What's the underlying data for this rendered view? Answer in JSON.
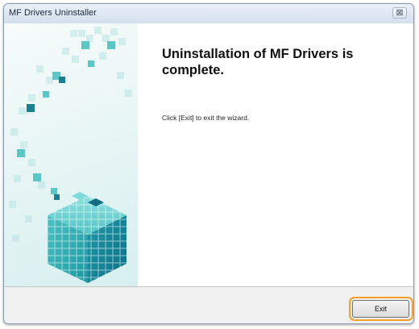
{
  "window": {
    "title": "MF Drivers Uninstaller",
    "close_icon": "close-icon",
    "close_glyph": "⊠"
  },
  "main": {
    "heading": "Uninstallation of MF Drivers is complete.",
    "instruction": "Click [Exit] to exit the wizard."
  },
  "footer": {
    "exit_label": "Exit"
  },
  "colors": {
    "highlight": "#f5a02a",
    "accent": "#2fb1b3"
  }
}
